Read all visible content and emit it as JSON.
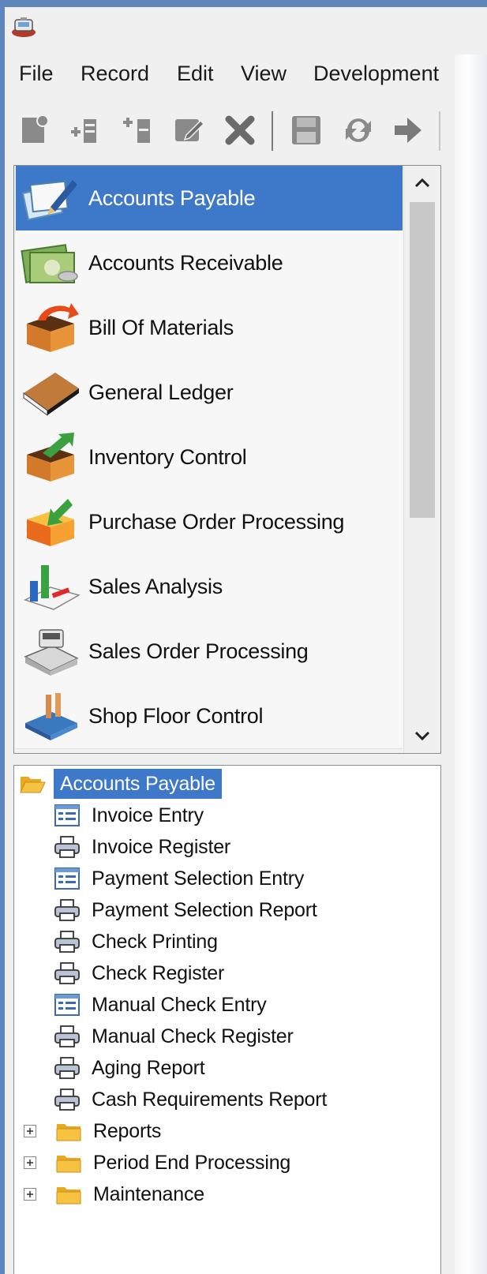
{
  "menu": {
    "items": [
      "File",
      "Record",
      "Edit",
      "View",
      "Development"
    ]
  },
  "toolbar": {
    "buttons": [
      "new-record-icon",
      "insert-before-icon",
      "insert-after-icon",
      "edit-record-icon",
      "delete-icon",
      "save-icon",
      "refresh-icon",
      "forward-arrow-icon"
    ]
  },
  "modules": {
    "items": [
      {
        "label": "Accounts Payable",
        "icon": "accounts-payable-icon",
        "selected": true
      },
      {
        "label": "Accounts Receivable",
        "icon": "money-icon"
      },
      {
        "label": "Bill Of Materials",
        "icon": "box-arrow-icon"
      },
      {
        "label": "General Ledger",
        "icon": "ledger-book-icon"
      },
      {
        "label": "Inventory Control",
        "icon": "box-up-arrow-icon"
      },
      {
        "label": "Purchase Order Processing",
        "icon": "box-in-arrow-icon"
      },
      {
        "label": "Sales Analysis",
        "icon": "bar-chart-icon"
      },
      {
        "label": "Sales Order Processing",
        "icon": "cash-register-icon"
      },
      {
        "label": "Shop Floor Control",
        "icon": "factory-icon"
      }
    ]
  },
  "tree": {
    "root": "Accounts Payable",
    "children": [
      {
        "label": "Invoice Entry",
        "icon": "form-icon"
      },
      {
        "label": "Invoice Register",
        "icon": "printer-icon"
      },
      {
        "label": "Payment Selection Entry",
        "icon": "form-icon"
      },
      {
        "label": "Payment Selection Report",
        "icon": "printer-icon"
      },
      {
        "label": "Check Printing",
        "icon": "printer-icon"
      },
      {
        "label": "Check Register",
        "icon": "printer-icon"
      },
      {
        "label": "Manual Check Entry",
        "icon": "form-icon"
      },
      {
        "label": "Manual Check Register",
        "icon": "printer-icon"
      },
      {
        "label": "Aging Report",
        "icon": "printer-icon"
      },
      {
        "label": "Cash Requirements Report",
        "icon": "printer-icon"
      }
    ],
    "folders": [
      "Reports",
      "Period End Processing",
      "Maintenance"
    ]
  },
  "colors": {
    "selection": "#3e78c8",
    "folder": "#f5c242",
    "desktop": "#5e86bd"
  }
}
